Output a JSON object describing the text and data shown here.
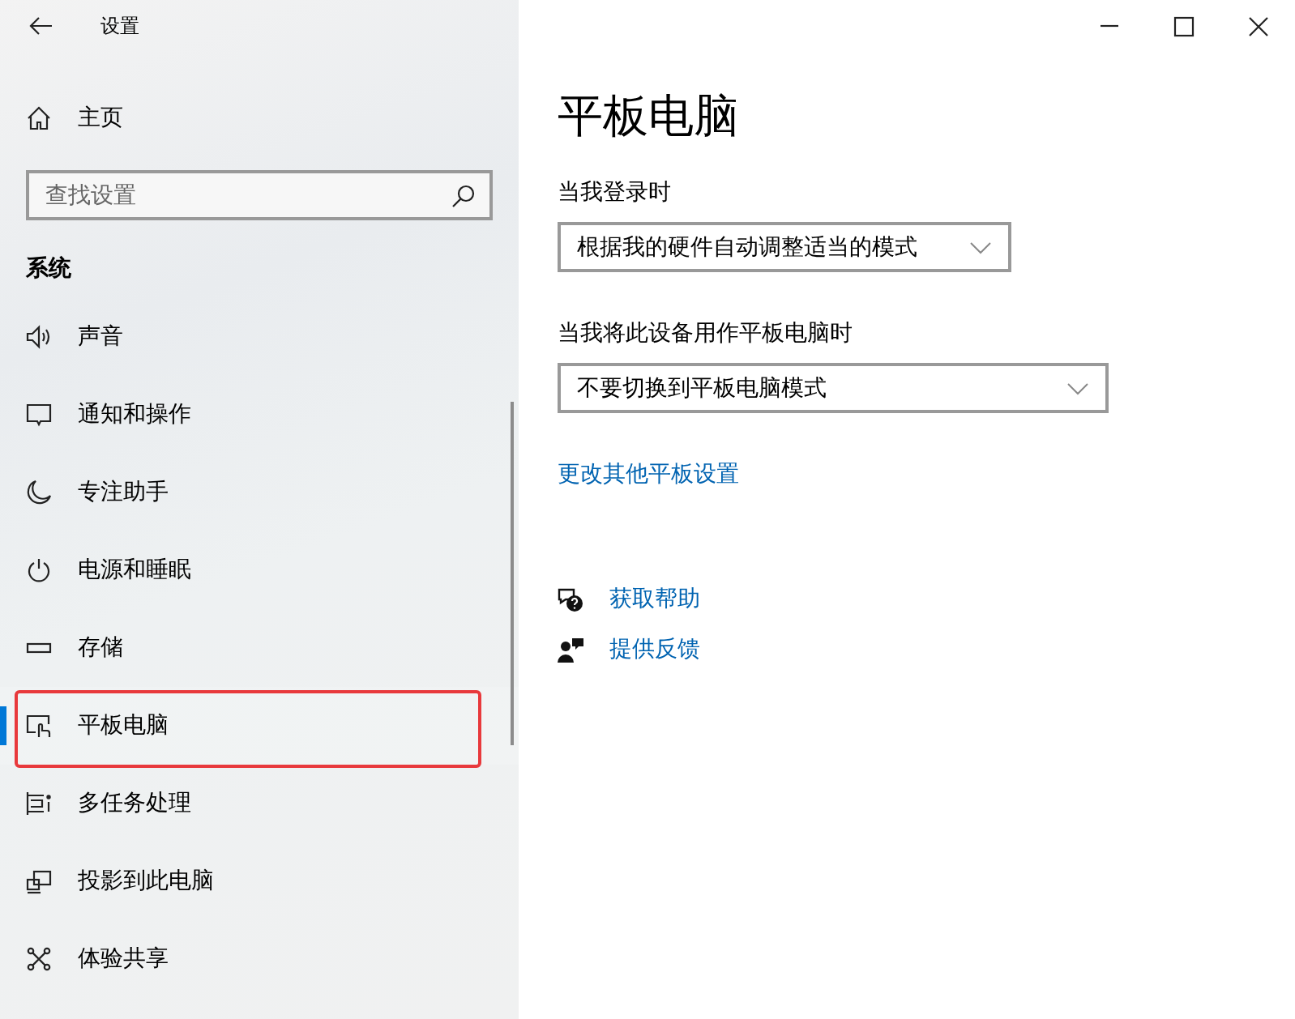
{
  "window": {
    "title": "设置"
  },
  "sidebar": {
    "home": {
      "label": "主页"
    },
    "search": {
      "placeholder": "查找设置"
    },
    "section": "系统",
    "items": [
      {
        "label": "声音",
        "selected": false,
        "highlighted": false
      },
      {
        "label": "通知和操作",
        "selected": false,
        "highlighted": false
      },
      {
        "label": "专注助手",
        "selected": false,
        "highlighted": false
      },
      {
        "label": "电源和睡眠",
        "selected": false,
        "highlighted": false
      },
      {
        "label": "存储",
        "selected": false,
        "highlighted": false
      },
      {
        "label": "平板电脑",
        "selected": true,
        "highlighted": true
      },
      {
        "label": "多任务处理",
        "selected": false,
        "highlighted": false
      },
      {
        "label": "投影到此电脑",
        "selected": false,
        "highlighted": false
      },
      {
        "label": "体验共享",
        "selected": false,
        "highlighted": false
      }
    ]
  },
  "page": {
    "title": "平板电脑",
    "settings": [
      {
        "label": "当我登录时",
        "value": "根据我的硬件自动调整适当的模式"
      },
      {
        "label": "当我将此设备用作平板电脑时",
        "value": "不要切换到平板电脑模式"
      }
    ],
    "link": "更改其他平板设置",
    "help_links": [
      "获取帮助",
      "提供反馈"
    ]
  }
}
